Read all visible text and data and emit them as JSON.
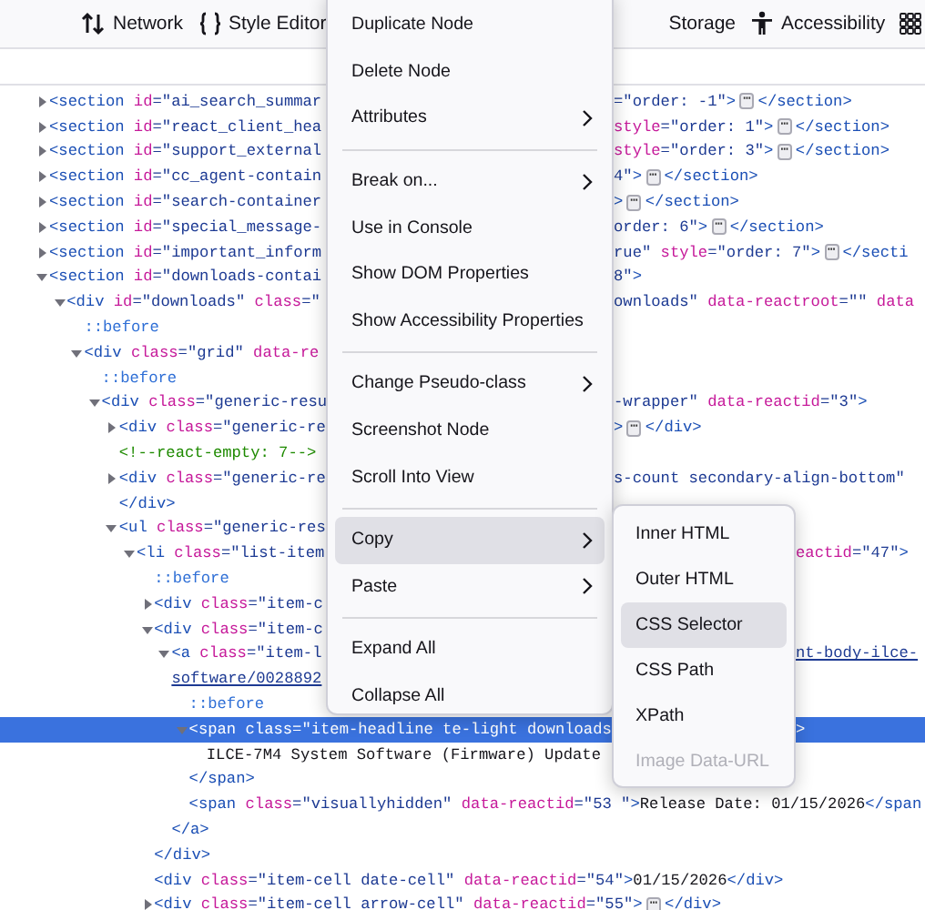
{
  "toolbar": {
    "tabs": [
      {
        "kind": "network",
        "label": "Network",
        "selected": false
      },
      {
        "kind": "style-editor",
        "label": "Style Editor",
        "selected": false
      },
      {
        "kind": "storage",
        "label": "Storage",
        "selected": false
      },
      {
        "kind": "accessibility",
        "label": "Accessibility",
        "selected": false
      }
    ]
  },
  "tree": [
    {
      "expanded": false,
      "selected": false,
      "left": [
        {
          "tag": "<section"
        },
        {
          "attr": " id"
        },
        {
          "value": "=\"ai_search_summar"
        }
      ],
      "right": [
        {
          "value": "=\"order: -1\""
        },
        {
          "tag": ">"
        },
        {
          "more": "⋯"
        },
        {
          "tag": "</section>"
        }
      ]
    },
    {
      "expanded": false,
      "selected": false,
      "left": [
        {
          "tag": "<section"
        },
        {
          "attr": " id"
        },
        {
          "value": "=\"react_client_hea"
        }
      ],
      "right": [
        {
          "attr": "style"
        },
        {
          "value": "=\"order: 1\""
        },
        {
          "tag": ">"
        },
        {
          "more": "⋯"
        },
        {
          "tag": "</section>"
        }
      ]
    },
    {
      "expanded": false,
      "selected": false,
      "left": [
        {
          "tag": "<section"
        },
        {
          "attr": " id"
        },
        {
          "value": "=\"support_external"
        }
      ],
      "right": [
        {
          "attr": "style"
        },
        {
          "value": "=\"order: 3\""
        },
        {
          "tag": ">"
        },
        {
          "more": "⋯"
        },
        {
          "tag": "</section>"
        }
      ]
    },
    {
      "expanded": false,
      "selected": false,
      "left": [
        {
          "tag": "<section"
        },
        {
          "attr": " id"
        },
        {
          "value": "=\"cc_agent-contain"
        }
      ],
      "right": [
        {
          "value": "4\""
        },
        {
          "tag": ">"
        },
        {
          "more": "⋯"
        },
        {
          "tag": "</section>"
        }
      ]
    },
    {
      "expanded": false,
      "selected": false,
      "left": [
        {
          "tag": "<section"
        },
        {
          "attr": " id"
        },
        {
          "value": "=\"search-container"
        }
      ],
      "right": [
        {
          "tag": ">"
        },
        {
          "more": "⋯"
        },
        {
          "tag": "</section>"
        }
      ]
    },
    {
      "expanded": false,
      "selected": false,
      "left": [
        {
          "tag": "<section"
        },
        {
          "attr": " id"
        },
        {
          "value": "=\"special_message-"
        }
      ],
      "right": [
        {
          "value": "order: 6\""
        },
        {
          "tag": ">"
        },
        {
          "more": "⋯"
        },
        {
          "tag": "</section>"
        }
      ]
    },
    {
      "expanded": false,
      "selected": false,
      "left": [
        {
          "tag": "<section"
        },
        {
          "attr": " id"
        },
        {
          "value": "=\"important_inform"
        }
      ],
      "right": [
        {
          "value": "rue\""
        },
        {
          "attr": " style"
        },
        {
          "value": "=\"order: 7\""
        },
        {
          "tag": ">"
        },
        {
          "more": "⋯"
        },
        {
          "tag": "</secti"
        }
      ]
    },
    {
      "expanded": true,
      "selected": false,
      "left": [
        {
          "tag": "<section"
        },
        {
          "attr": " id"
        },
        {
          "value": "=\"downloads-contai"
        }
      ],
      "right": [
        {
          "value": "8\""
        },
        {
          "tag": ">"
        }
      ],
      "children": [
        {
          "expanded": true,
          "selected": false,
          "left": [
            {
              "tag": "<div"
            },
            {
              "attr": " id"
            },
            {
              "value": "=\"downloads\""
            },
            {
              "attr": " class"
            },
            {
              "value": "=\""
            }
          ],
          "right": [
            {
              "value": "ownloads\""
            },
            {
              "attr": " data-reactroot"
            },
            {
              "value": "=\"\""
            },
            {
              "attr": " data"
            }
          ],
          "children": [
            {
              "selected": false,
              "left": [
                {
                  "pseudo": "::before"
                }
              ]
            },
            {
              "expanded": true,
              "selected": false,
              "left": [
                {
                  "tag": "<div"
                },
                {
                  "attr": " class"
                },
                {
                  "value": "=\"grid\""
                },
                {
                  "attr": " data-re"
                }
              ],
              "children": [
                {
                  "selected": false,
                  "left": [
                    {
                      "pseudo": "::before"
                    }
                  ]
                },
                {
                  "expanded": true,
                  "selected": false,
                  "left": [
                    {
                      "tag": "<div"
                    },
                    {
                      "attr": " class"
                    },
                    {
                      "value": "=\"generic-resu"
                    }
                  ],
                  "right": [
                    {
                      "value": "-wrapper\""
                    },
                    {
                      "attr": " data-reactid"
                    },
                    {
                      "value": "=\"3\""
                    },
                    {
                      "tag": ">"
                    }
                  ],
                  "children": [
                    {
                      "expanded": false,
                      "selected": false,
                      "left": [
                        {
                          "tag": "<div"
                        },
                        {
                          "attr": " class"
                        },
                        {
                          "value": "=\"generic-re"
                        }
                      ],
                      "right": [
                        {
                          "tag": ">"
                        },
                        {
                          "more": "⋯"
                        },
                        {
                          "tag": "</div>"
                        }
                      ]
                    },
                    {
                      "selected": false,
                      "left": [
                        {
                          "comment": "<!--react-empty: 7-->"
                        }
                      ]
                    },
                    {
                      "expanded": false,
                      "selected": false,
                      "left": [
                        {
                          "tag": "<div"
                        },
                        {
                          "attr": " class"
                        },
                        {
                          "value": "=\"generic-re"
                        }
                      ],
                      "right": [
                        {
                          "value": "s-count secondary-align-bottom\""
                        }
                      ]
                    },
                    {
                      "selected": false,
                      "left": [
                        {
                          "tag": "</div>"
                        }
                      ]
                    },
                    {
                      "expanded": true,
                      "selected": false,
                      "left": [
                        {
                          "tag": "<ul"
                        },
                        {
                          "attr": " class"
                        },
                        {
                          "value": "=\"generic-res"
                        }
                      ],
                      "children": [
                        {
                          "expanded": true,
                          "selected": false,
                          "left": [
                            {
                              "tag": "<li"
                            },
                            {
                              "attr": " class"
                            },
                            {
                              "value": "=\"list-item"
                            }
                          ],
                          "right": [
                            {
                              "attr": "eactid"
                            },
                            {
                              "value": "=\"47\""
                            },
                            {
                              "tag": ">"
                            }
                          ],
                          "children": [
                            {
                              "selected": false,
                              "left": [
                                {
                                  "pseudo": "::before"
                                }
                              ]
                            },
                            {
                              "expanded": false,
                              "selected": false,
                              "left": [
                                {
                                  "tag": "<div"
                                },
                                {
                                  "attr": " class"
                                },
                                {
                                  "value": "=\"item-c"
                                }
                              ]
                            },
                            {
                              "expanded": true,
                              "selected": false,
                              "left": [
                                {
                                  "tag": "<div"
                                },
                                {
                                  "attr": " class"
                                },
                                {
                                  "value": "=\"item-c"
                                }
                              ],
                              "children": [
                                {
                                  "expanded": true,
                                  "selected": false,
                                  "left": [
                                    {
                                      "tag": "<a"
                                    },
                                    {
                                      "attr": " class"
                                    },
                                    {
                                      "value": "=\"item-l"
                                    }
                                  ],
                                  "right": [
                                    {
                                      "link": "nt-body-ilce-"
                                    }
                                  ],
                                  "wrap": [
                                    {
                                      "link": "software/0028892"
                                    }
                                  ],
                                  "children": [
                                    {
                                      "selected": false,
                                      "left": [
                                        {
                                          "pseudo": "::before"
                                        }
                                      ]
                                    },
                                    {
                                      "expanded": true,
                                      "selected": true,
                                      "left": [
                                        {
                                          "tag": "<span"
                                        },
                                        {
                                          "attr": " class"
                                        },
                                        {
                                          "value": "=\"item-headline te-light downloads"
                                        }
                                      ],
                                      "right": [
                                        {
                                          "tag": ">"
                                        }
                                      ],
                                      "children": [
                                        {
                                          "selected": false,
                                          "left": [
                                            {
                                              "text": "ILCE-7M4 System Software (Firmware) Update"
                                            }
                                          ]
                                        }
                                      ]
                                    },
                                    {
                                      "selected": false,
                                      "left": [
                                        {
                                          "tag": "</span>"
                                        }
                                      ]
                                    },
                                    {
                                      "selected": false,
                                      "left": [
                                        {
                                          "tag": "<span"
                                        },
                                        {
                                          "attr": " class"
                                        },
                                        {
                                          "value": "=\"visuallyhidden\""
                                        },
                                        {
                                          "attr": " data-reactid"
                                        },
                                        {
                                          "value": "=\"53 \""
                                        },
                                        {
                                          "tag": ">"
                                        },
                                        {
                                          "text": "Release Date: 01/15/2026"
                                        },
                                        {
                                          "tag": "</span"
                                        }
                                      ]
                                    }
                                  ]
                                },
                                {
                                  "selected": false,
                                  "left": [
                                    {
                                      "tag": "</a>"
                                    }
                                  ]
                                }
                              ]
                            },
                            {
                              "selected": false,
                              "left": [
                                {
                                  "tag": "</div>"
                                }
                              ]
                            },
                            {
                              "selected": false,
                              "left": [
                                {
                                  "tag": "<div"
                                },
                                {
                                  "attr": " class"
                                },
                                {
                                  "value": "=\"item-cell date-cell\""
                                },
                                {
                                  "attr": " data-reactid"
                                },
                                {
                                  "value": "=\"54\""
                                },
                                {
                                  "tag": ">"
                                },
                                {
                                  "text": "01/15/2026"
                                },
                                {
                                  "tag": "</div>"
                                }
                              ]
                            },
                            {
                              "expanded": false,
                              "selected": false,
                              "left": [
                                {
                                  "tag": "<div"
                                },
                                {
                                  "attr": " class"
                                },
                                {
                                  "value": "=\"item-cell arrow-cell\""
                                },
                                {
                                  "attr": " data-reactid"
                                },
                                {
                                  "value": "=\"55\""
                                },
                                {
                                  "tag": ">"
                                },
                                {
                                  "more": "⋯"
                                },
                                {
                                  "tag": "</div>"
                                }
                              ]
                            }
                          ]
                        }
                      ]
                    }
                  ]
                }
              ]
            }
          ]
        }
      ]
    }
  ],
  "context_menu": {
    "items": [
      {
        "kind": "item",
        "label": "Duplicate Node",
        "submenu": false,
        "selected": false
      },
      {
        "kind": "item",
        "label": "Delete Node",
        "submenu": false,
        "selected": false
      },
      {
        "kind": "item",
        "label": "Attributes",
        "submenu": true,
        "selected": false
      },
      {
        "kind": "separator"
      },
      {
        "kind": "item",
        "label": "Break on...",
        "submenu": true,
        "selected": false
      },
      {
        "kind": "item",
        "label": "Use in Console",
        "submenu": false,
        "selected": false
      },
      {
        "kind": "item",
        "label": "Show DOM Properties",
        "submenu": false,
        "selected": false
      },
      {
        "kind": "item",
        "label": "Show Accessibility Properties",
        "submenu": false,
        "selected": false
      },
      {
        "kind": "separator"
      },
      {
        "kind": "item",
        "label": "Change Pseudo-class",
        "submenu": true,
        "selected": false
      },
      {
        "kind": "item",
        "label": "Screenshot Node",
        "submenu": false,
        "selected": false
      },
      {
        "kind": "item",
        "label": "Scroll Into View",
        "submenu": false,
        "selected": false
      },
      {
        "kind": "separator"
      },
      {
        "kind": "item",
        "label": "Copy",
        "submenu": true,
        "selected": true
      },
      {
        "kind": "item",
        "label": "Paste",
        "submenu": true,
        "selected": false
      },
      {
        "kind": "separator"
      },
      {
        "kind": "item",
        "label": "Expand All",
        "submenu": false,
        "selected": false
      },
      {
        "kind": "item",
        "label": "Collapse All",
        "submenu": false,
        "selected": false
      }
    ]
  },
  "copy_submenu": {
    "items": [
      {
        "label": "Inner HTML",
        "selected": false,
        "disabled": false
      },
      {
        "label": "Outer HTML",
        "selected": false,
        "disabled": false
      },
      {
        "label": "CSS Selector",
        "selected": true,
        "disabled": false
      },
      {
        "label": "CSS Path",
        "selected": false,
        "disabled": false
      },
      {
        "label": "XPath",
        "selected": false,
        "disabled": false
      },
      {
        "label": "Image Data-URL",
        "selected": false,
        "disabled": true
      }
    ]
  }
}
